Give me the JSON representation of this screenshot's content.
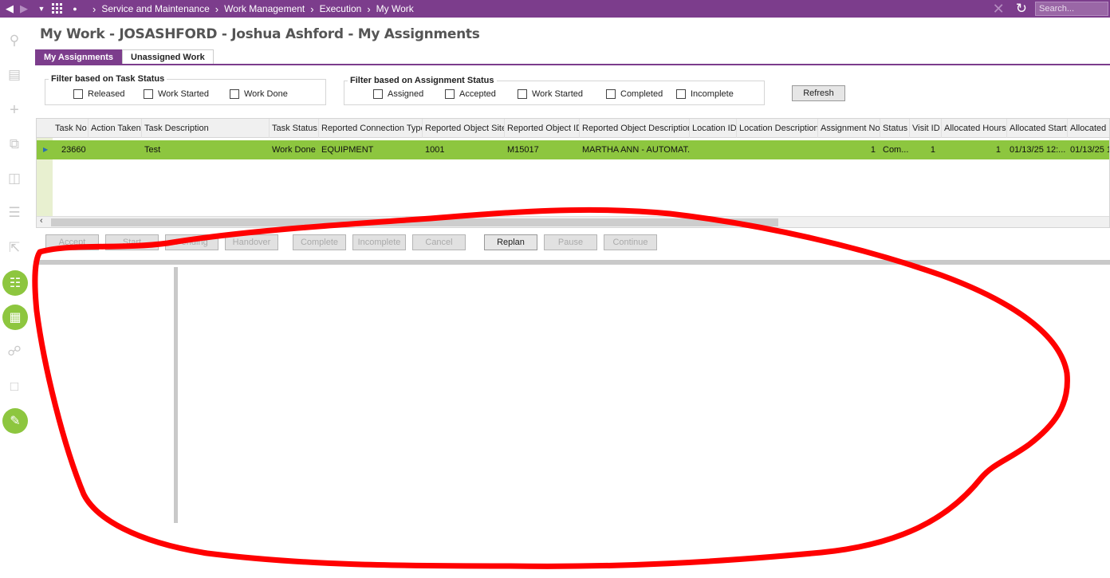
{
  "topbar": {
    "breadcrumb": [
      "Service and Maintenance",
      "Work Management",
      "Execution",
      "My Work"
    ],
    "search_placeholder": "Search...",
    "background": "#7c3d8c"
  },
  "page": {
    "title": "My Work - JOSASHFORD - Joshua Ashford - My Assignments"
  },
  "tabs": [
    {
      "label": "My Assignments",
      "active": true
    },
    {
      "label": "Unassigned Work",
      "active": false
    }
  ],
  "filters": {
    "task_status": {
      "legend": "Filter based on Task Status",
      "options": [
        "Released",
        "Work Started",
        "Work Done"
      ]
    },
    "assignment_status": {
      "legend": "Filter based on Assignment Status",
      "options": [
        "Assigned",
        "Accepted",
        "Work Started",
        "Completed",
        "Incomplete"
      ]
    },
    "refresh_label": "Refresh"
  },
  "grid": {
    "columns": [
      "Task No",
      "Action Taken",
      "Task Description",
      "Task Status",
      "Reported Connection Type",
      "Reported Object Site",
      "Reported Object ID",
      "Reported Object Description",
      "Location ID",
      "Location Description",
      "Assignment No",
      "Status",
      "Visit ID",
      "Allocated Hours",
      "Allocated Start",
      "Allocated F"
    ],
    "rows": [
      {
        "task_no": "23660",
        "action_taken": "",
        "task_description": "Test",
        "task_status": "Work Done",
        "connection_type": "EQUIPMENT",
        "object_site": "1001",
        "object_id": "M15017",
        "object_description": "MARTHA ANN - AUTOMAT...",
        "location_id": "",
        "location_description": "",
        "assignment_no": "1",
        "status": "Com...",
        "visit_id": "1",
        "allocated_hours": "1",
        "allocated_start": "01/13/25 12:...",
        "allocated_f": "01/13/25 1:"
      }
    ],
    "row_color": "#8dc63f"
  },
  "actions": [
    {
      "label": "Accept",
      "enabled": false
    },
    {
      "label": "Start",
      "enabled": false
    },
    {
      "label": "Pending",
      "enabled": false
    },
    {
      "label": "Handover",
      "enabled": false
    },
    {
      "label": "Complete",
      "enabled": false
    },
    {
      "label": "Incomplete",
      "enabled": false
    },
    {
      "label": "Cancel",
      "enabled": false
    },
    {
      "label": "Replan",
      "enabled": true
    },
    {
      "label": "Pause",
      "enabled": false
    },
    {
      "label": "Continue",
      "enabled": false
    }
  ],
  "sidebar": {
    "icons": [
      "search-icon",
      "form-icon",
      "plus-icon",
      "copy-icon",
      "trash-icon",
      "list-icon",
      "export-icon",
      "document-list-icon",
      "chart-icon",
      "attachment-icon",
      "note-icon",
      "chat-add-icon"
    ]
  },
  "annotation": {
    "color": "#ff0000"
  }
}
